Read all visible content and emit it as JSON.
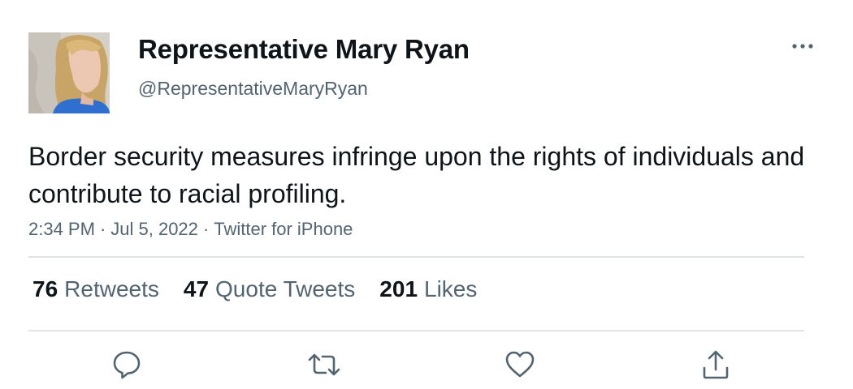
{
  "tweet": {
    "author": {
      "display_name": "Representative Mary Ryan",
      "handle": "@RepresentativeMaryRyan",
      "avatar_icon": "profile-photo"
    },
    "text": "Border security measures infringe upon the rights of individuals and contribute to racial profiling.",
    "time": "2:34 PM",
    "date": "Jul 5, 2022",
    "source": "Twitter for iPhone",
    "separator": "·",
    "more_icon": "more-horizontal-icon"
  },
  "stats": {
    "retweets": {
      "count": "76",
      "label": "Retweets"
    },
    "quote_tweets": {
      "count": "47",
      "label": "Quote Tweets"
    },
    "likes": {
      "count": "201",
      "label": "Likes"
    }
  },
  "actions": [
    {
      "name": "reply",
      "icon": "reply-icon"
    },
    {
      "name": "retweet",
      "icon": "retweet-icon"
    },
    {
      "name": "like",
      "icon": "like-icon"
    },
    {
      "name": "share",
      "icon": "share-icon"
    }
  ],
  "colors": {
    "text_primary": "#0f1419",
    "text_secondary": "#536471",
    "divider": "#dfe3e6",
    "icon": "#536471"
  }
}
